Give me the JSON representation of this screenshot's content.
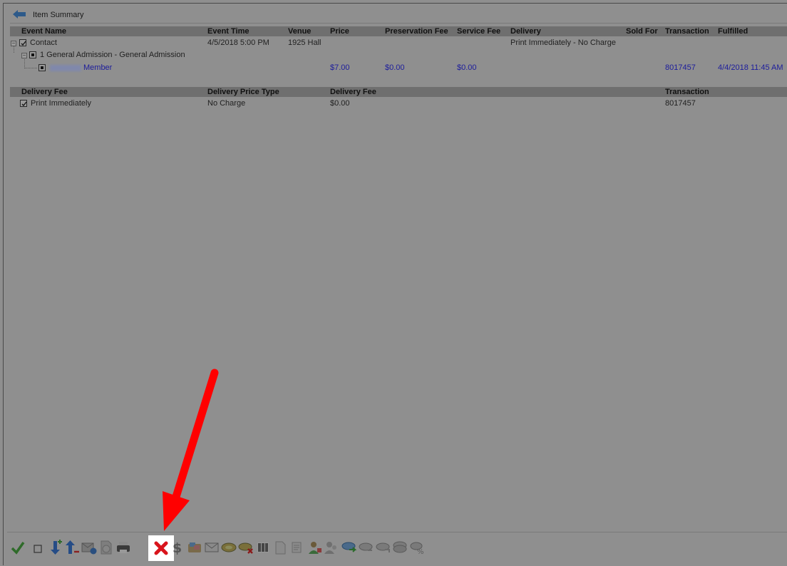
{
  "window": {
    "title": "Item Summary"
  },
  "items_table": {
    "headers": {
      "event_name": "Event Name",
      "event_time": "Event Time",
      "venue": "Venue",
      "price": "Price",
      "preservation_fee": "Preservation Fee",
      "service_fee": "Service Fee",
      "delivery": "Delivery",
      "sold_for": "Sold For",
      "transaction": "Transaction",
      "fulfilled": "Fulfilled"
    },
    "contact_row": {
      "name": "Contact",
      "event_time": "4/5/2018 5:00 PM",
      "venue": "1925 Hall",
      "delivery": "Print Immediately - No Charge"
    },
    "admission_row": {
      "name": "1 General Admission - General Admission"
    },
    "member_row": {
      "name": "Member",
      "price": "$7.00",
      "preservation_fee": "$0.00",
      "service_fee": "$0.00",
      "transaction": "8017457",
      "fulfilled": "4/4/2018 11:45 AM"
    }
  },
  "delivery_table": {
    "headers": {
      "delivery_fee": "Delivery Fee",
      "delivery_price_type": "Delivery Price Type",
      "delivery_fee_amount": "Delivery Fee",
      "transaction": "Transaction"
    },
    "row": {
      "name": "Print Immediately",
      "price_type": "No Charge",
      "fee": "$0.00",
      "transaction": "8017457"
    }
  },
  "toolbar": {
    "icons": [
      "checkmark-icon",
      "square-icon",
      "move-down-icon",
      "move-up-icon",
      "mail-info-icon",
      "info-icon",
      "printer-icon",
      "delete-icon",
      "dollar-icon",
      "gift-icon",
      "envelope-icon",
      "ticket-icon",
      "ticket-delete-icon",
      "barcode-icon",
      "document-icon",
      "scroll-icon",
      "user-icon",
      "users-icon",
      "ticket-arrow-icon",
      "ticket-left-icon",
      "ticket-refresh-icon",
      "ticket-stack-icon",
      "percent-icon"
    ],
    "highlighted": "delete-icon"
  },
  "colors": {
    "annotation_arrow": "#ff0000",
    "link_text": "#1c1c9c",
    "background": "#8f8f8f"
  }
}
